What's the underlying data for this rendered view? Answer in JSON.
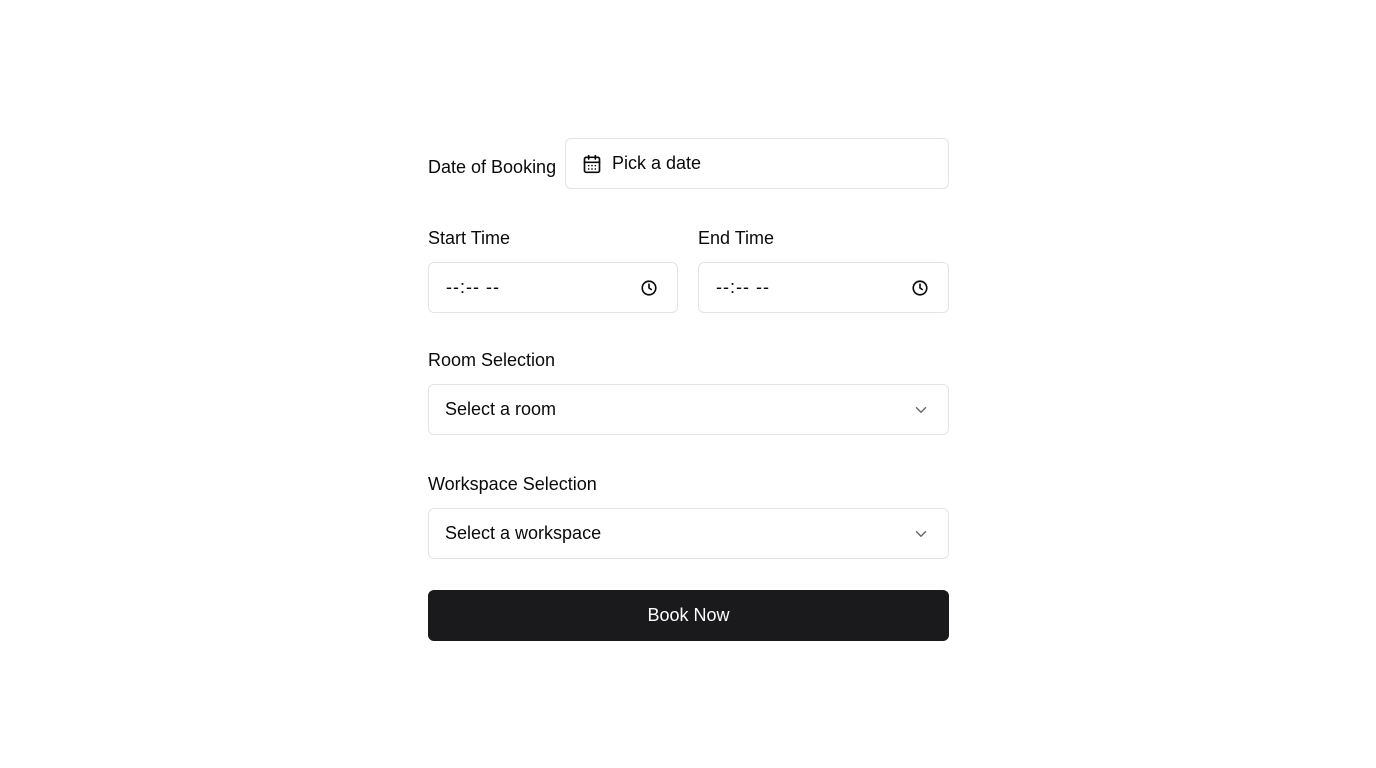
{
  "form": {
    "date": {
      "label": "Date of Booking",
      "placeholder": "Pick a date",
      "icon": "calendar-icon"
    },
    "start_time": {
      "label": "Start Time",
      "value": "--:-- --",
      "icon": "clock-icon"
    },
    "end_time": {
      "label": "End Time",
      "value": "--:-- --",
      "icon": "clock-icon"
    },
    "room": {
      "label": "Room Selection",
      "placeholder": "Select a room",
      "icon": "chevron-down-icon"
    },
    "workspace": {
      "label": "Workspace Selection",
      "placeholder": "Select a workspace",
      "icon": "chevron-down-icon"
    },
    "submit_label": "Book Now"
  },
  "colors": {
    "background": "#ffffff",
    "border": "#e4e4e7",
    "button_bg": "#1a1a1c",
    "button_text": "#ffffff",
    "text": "#0a0a0a"
  }
}
